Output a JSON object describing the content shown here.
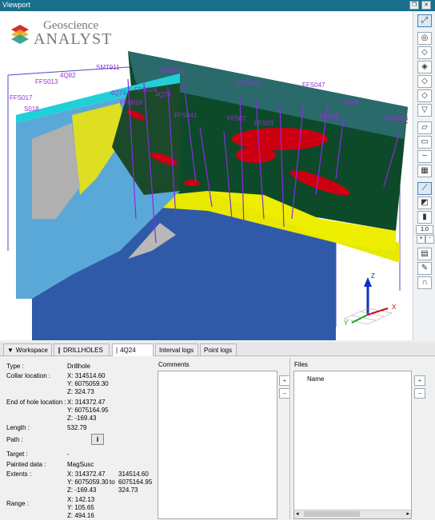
{
  "window": {
    "title": "Viewport"
  },
  "logo": {
    "line1": "Geoscience",
    "line2": "ANALYST"
  },
  "toolbar": {
    "zoom_value": "1.0",
    "zoom_plus": "+",
    "zoom_minus": "-"
  },
  "drillhole_labels": [
    {
      "text": "SMT911"
    },
    {
      "text": "FFS040"
    },
    {
      "text": "4Q82"
    },
    {
      "text": "FFS017"
    },
    {
      "text": "S018"
    },
    {
      "text": "FFS041"
    },
    {
      "text": "FFS033"
    },
    {
      "text": "FFS047"
    },
    {
      "text": "4Q88"
    },
    {
      "text": "FFS08"
    },
    {
      "text": "FFS014"
    },
    {
      "text": "FFS07"
    },
    {
      "text": "FFS013"
    },
    {
      "text": "FFS016"
    },
    {
      "text": "FFS024"
    },
    {
      "text": "4Q79"
    },
    {
      "text": "4Q74"
    },
    {
      "text": "FFS03"
    }
  ],
  "axes": {
    "z": "Z",
    "y": "Y",
    "x": "X"
  },
  "tabs": [
    {
      "label": "Workspace",
      "icon": "workspace-icon"
    },
    {
      "label": "DRILLHOLES",
      "icon": "drillholes-icon"
    },
    {
      "label": "4Q24",
      "icon": "drillhole-icon",
      "active": true
    },
    {
      "label": "Interval logs"
    },
    {
      "label": "Point logs"
    }
  ],
  "properties": {
    "type_label": "Type :",
    "type_value": "Drillhole",
    "collar_label": "Collar location :",
    "collar_value": "X: 314514.60\nY: 6075059.30\nZ: 324.73",
    "eoh_label": "End of hole location :",
    "eoh_value": "X: 314372.47\nY: 6075164.95\nZ: -169.43",
    "length_label": "Length :",
    "length_value": "532.79",
    "path_label": "Path :",
    "path_button": "i",
    "target_label": "Target :",
    "target_value": "-",
    "painted_label": "Painted data :",
    "painted_value": "MagSusc",
    "extents_label": "Extents :",
    "extents_from": "X: 314372.47\nY: 6075059.30\nZ: -169.43",
    "extents_to_word": "to",
    "extents_to": "314514.60\n6075164.95\n324.73",
    "range_label": "Range :",
    "range_value": "X: 142.13\nY: 105.65\nZ: 494.16"
  },
  "comments": {
    "title": "Comments"
  },
  "files": {
    "title": "Files",
    "column_name": "Name"
  }
}
